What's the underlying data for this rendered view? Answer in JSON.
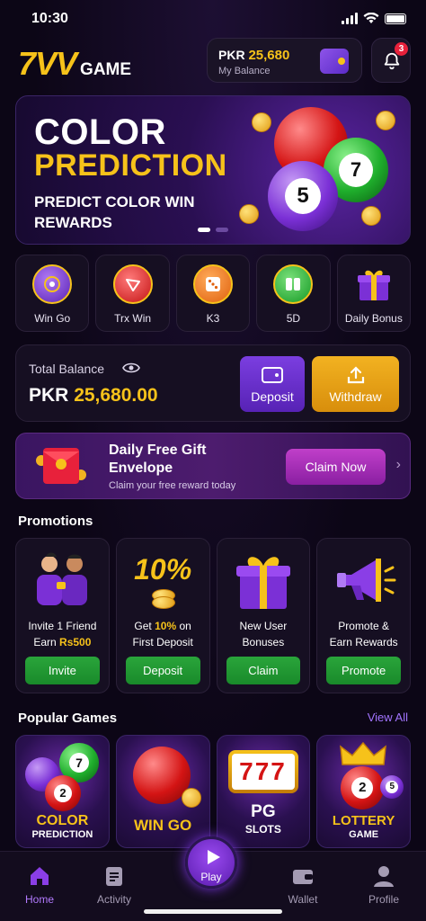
{
  "status": {
    "time": "10:30"
  },
  "header": {
    "logo_main": "7VV",
    "logo_sub": "GAME",
    "balance_currency": "PKR",
    "balance_amount": "25,680",
    "balance_label": "My Balance",
    "notification_count": "3"
  },
  "hero": {
    "title_line1": "COLOR",
    "title_line2": "PREDICTION",
    "subtitle": "PREDICT COLOR WIN REWARDS",
    "ball_numbers": [
      "7",
      "5"
    ]
  },
  "shortcuts": [
    {
      "label": "Win Go",
      "icon": "wingo-icon"
    },
    {
      "label": "Trx Win",
      "icon": "trx-icon"
    },
    {
      "label": "K3",
      "icon": "k3-dice-icon"
    },
    {
      "label": "5D",
      "icon": "5d-icon"
    },
    {
      "label": "Daily Bonus",
      "icon": "gift-box-icon"
    }
  ],
  "total_balance": {
    "label": "Total Balance",
    "currency": "PKR",
    "amount": "25,680.00",
    "deposit_label": "Deposit",
    "withdraw_label": "Withdraw"
  },
  "gift_banner": {
    "title": "Daily Free Gift Envelope",
    "subtitle": "Claim your free reward today",
    "button": "Claim Now"
  },
  "promotions": {
    "heading": "Promotions",
    "items": [
      {
        "line1": "Invite 1 Friend",
        "line2_prefix": "Earn ",
        "line2_highlight": "Rs500",
        "button": "Invite"
      },
      {
        "line1_prefix": "Get ",
        "line1_highlight": "10%",
        "line1_suffix": " on",
        "line2": "First Deposit",
        "art_text": "10%",
        "button": "Deposit"
      },
      {
        "line1": "New User",
        "line2": "Bonuses",
        "button": "Claim"
      },
      {
        "line1": "Promote &",
        "line2": "Earn Rewards",
        "button": "Promote"
      }
    ]
  },
  "popular_games": {
    "heading": "Popular Games",
    "view_all": "View All",
    "items": [
      {
        "title": "COLOR",
        "subtitle": "PREDICTION",
        "balls": [
          "7",
          "2"
        ]
      },
      {
        "title": "WIN GO"
      },
      {
        "title": "PG",
        "subtitle": "SLOTS",
        "reels": "777"
      },
      {
        "title": "LOTTERY",
        "subtitle": "GAME",
        "balls": [
          "2",
          "5"
        ]
      }
    ]
  },
  "nav": {
    "home": "Home",
    "activity": "Activity",
    "play": "Play",
    "wallet": "Wallet",
    "profile": "Profile"
  },
  "colors": {
    "accent_gold": "#f6c21a",
    "accent_purple": "#7b3ee0",
    "green_button": "#2aa53b",
    "background": "#0d0717"
  }
}
